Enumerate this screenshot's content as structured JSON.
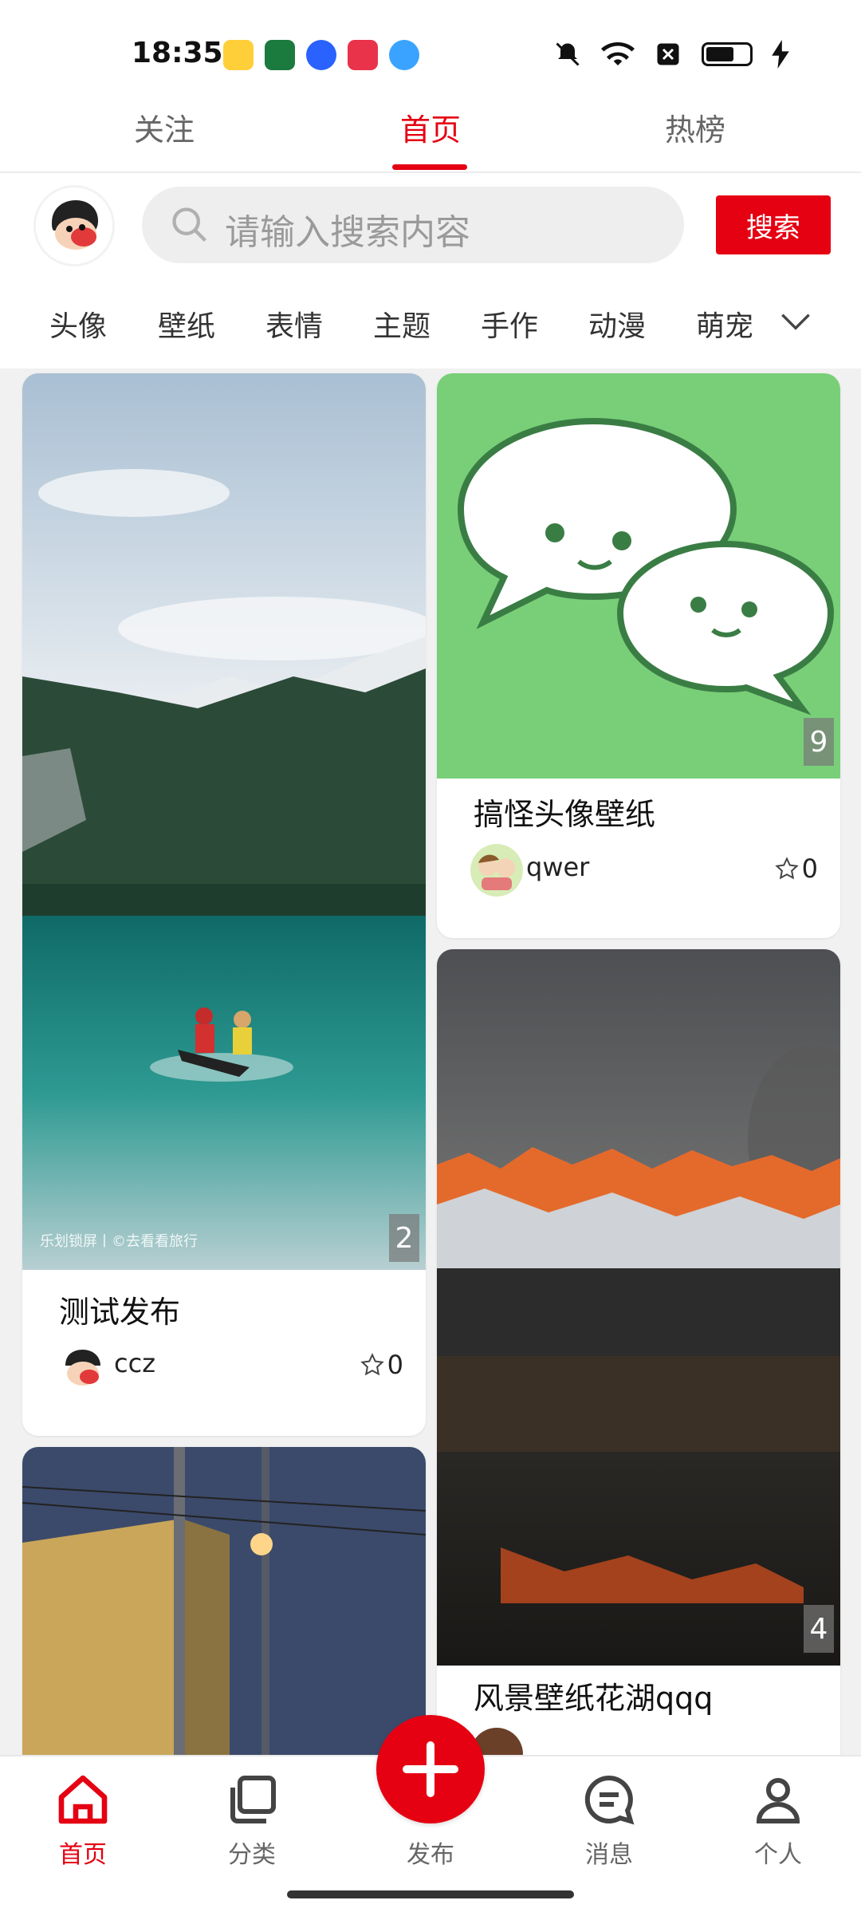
{
  "status_bar": {
    "time": "18:35"
  },
  "top_tabs": [
    {
      "label": "关注",
      "active": false
    },
    {
      "label": "首页",
      "active": true
    },
    {
      "label": "热榜",
      "active": false
    }
  ],
  "search": {
    "placeholder": "请输入搜索内容",
    "button_label": "搜索"
  },
  "categories": [
    "头像",
    "壁纸",
    "表情",
    "主题",
    "手作",
    "动漫",
    "萌宠"
  ],
  "cards": [
    {
      "title": "测试发布",
      "author": "ccz",
      "likes": "0",
      "image_count": "2",
      "watermark": "乐划锁屏丨©去看看旅行"
    },
    {
      "title": "搞怪头像壁纸",
      "author": "qwer",
      "likes": "0",
      "image_count": "9"
    },
    {
      "title": "风景壁纸花湖qqq",
      "image_count": "4"
    }
  ],
  "bottom_nav": {
    "home": "首页",
    "category": "分类",
    "publish": "发布",
    "message": "消息",
    "profile": "个人"
  },
  "colors": {
    "accent": "#e50012",
    "feed_bg": "#f1f1f1"
  }
}
